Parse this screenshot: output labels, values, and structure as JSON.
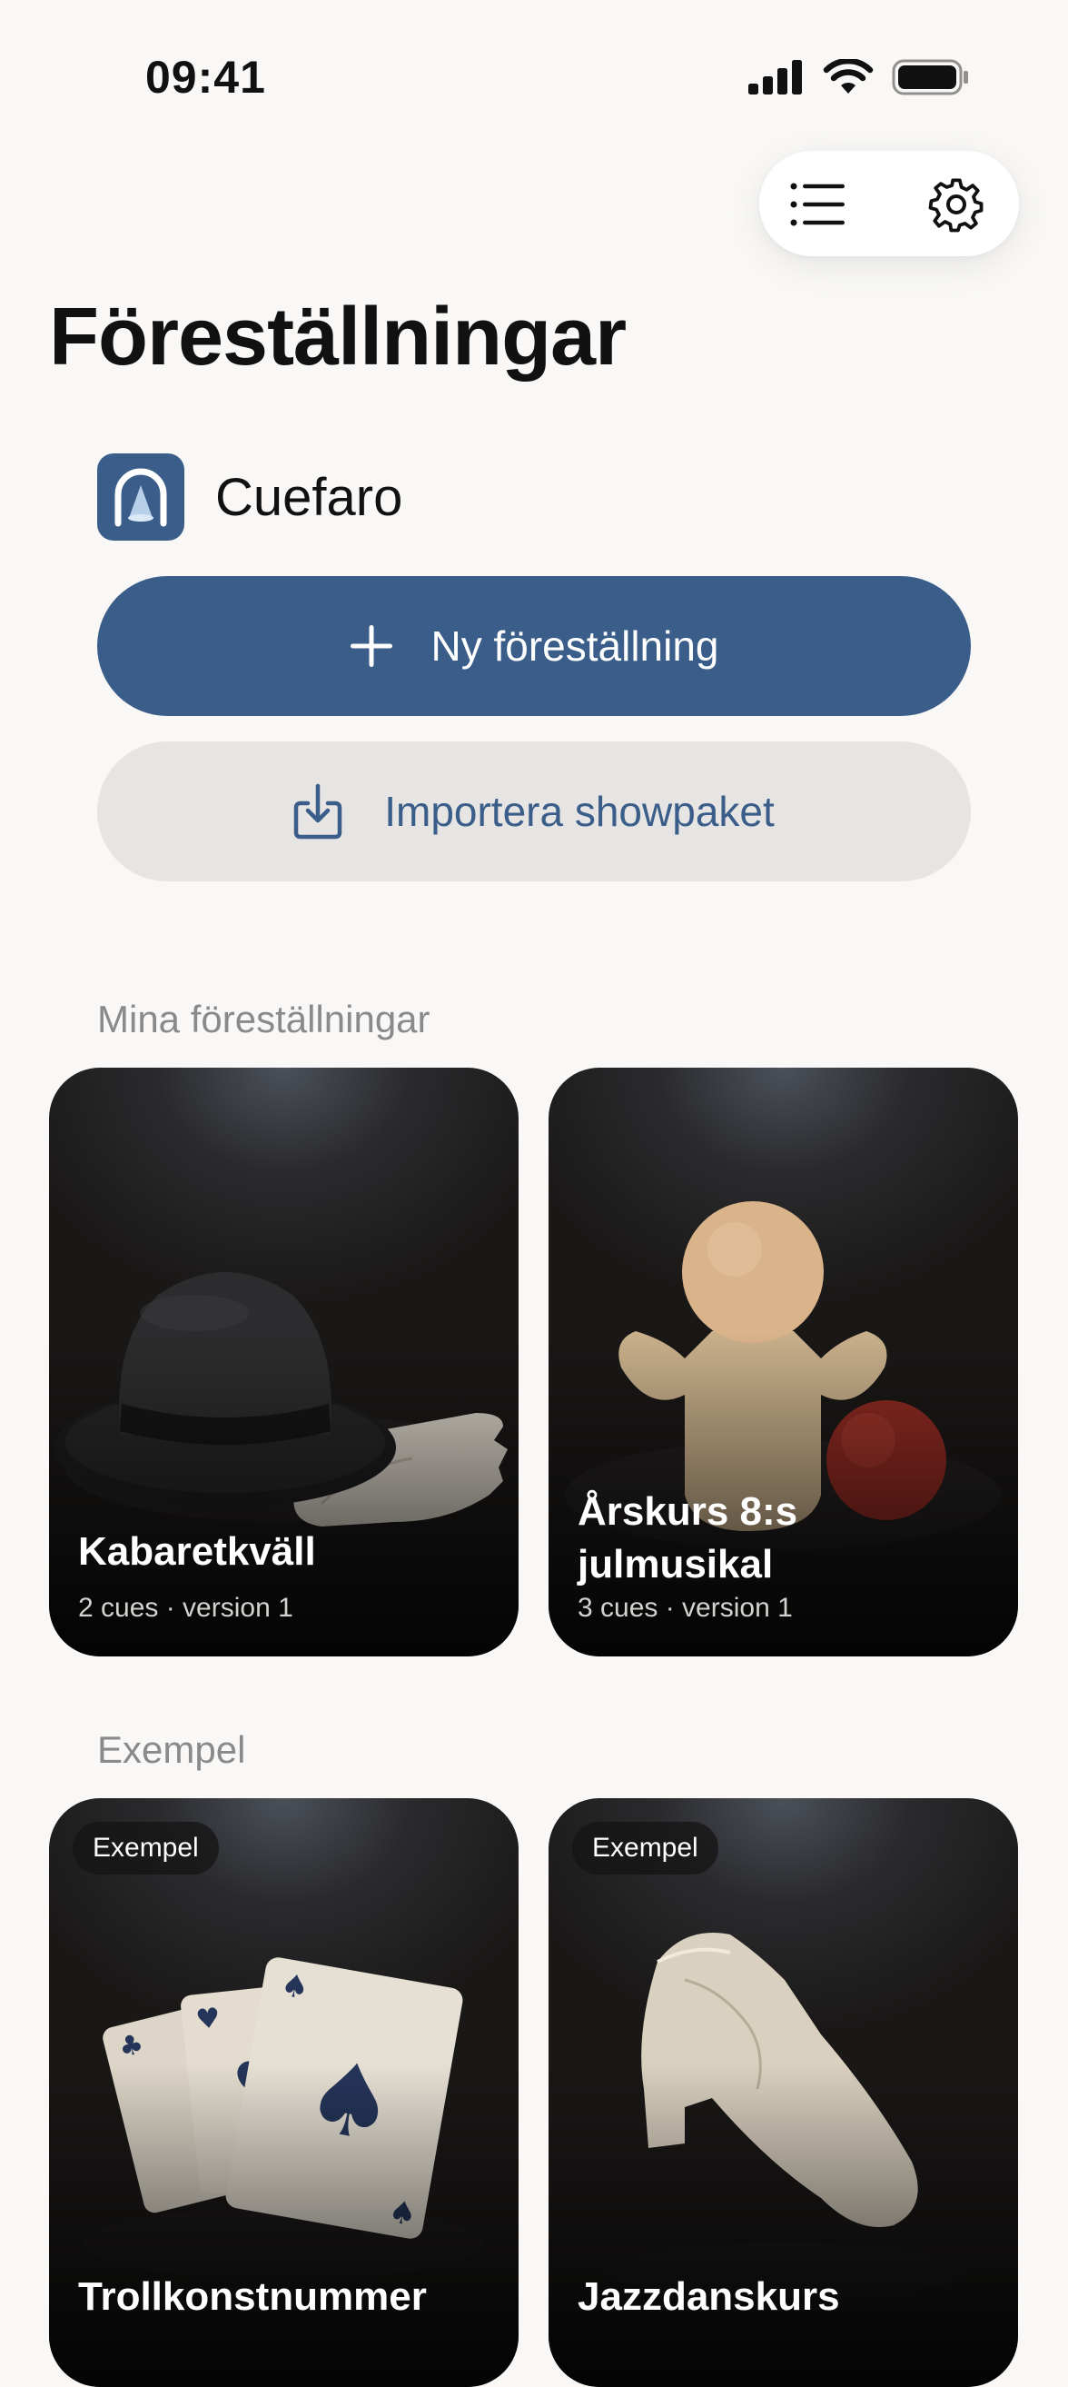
{
  "status_bar": {
    "time": "09:41",
    "icons": [
      "cellular-signal-icon",
      "wifi-icon",
      "battery-icon"
    ]
  },
  "toolbar": {
    "icons": [
      "list-icon",
      "gear-icon"
    ]
  },
  "page": {
    "title": "Föreställningar"
  },
  "app": {
    "name": "Cuefaro",
    "logo_icon": "spotlight-logo-icon"
  },
  "actions": {
    "new_show_label": "Ny föreställning",
    "import_label": "Importera showpaket"
  },
  "my_shows": {
    "header": "Mina föreställningar",
    "cards": [
      {
        "title": "Kabaretkväll",
        "meta": "2 cues · version 1",
        "image_icon": "bowler-hat-and-gloves-image"
      },
      {
        "title": "Årskurs 8:s julmusikal",
        "meta": "3 cues · version 1",
        "image_icon": "hand-puppet-and-ball-image"
      }
    ]
  },
  "examples": {
    "header": "Exempel",
    "cards": [
      {
        "badge": "Exempel",
        "title": "Trollkonstnummer",
        "image_icon": "playing-cards-image"
      },
      {
        "badge": "Exempel",
        "title": "Jazzdanskurs",
        "image_icon": "jazz-shoe-image"
      }
    ]
  },
  "colors": {
    "accent": "#3a5d8a",
    "background": "#f9f8f6",
    "secondary_button": "#e6e5e3",
    "section_header": "#8a8a8a"
  }
}
